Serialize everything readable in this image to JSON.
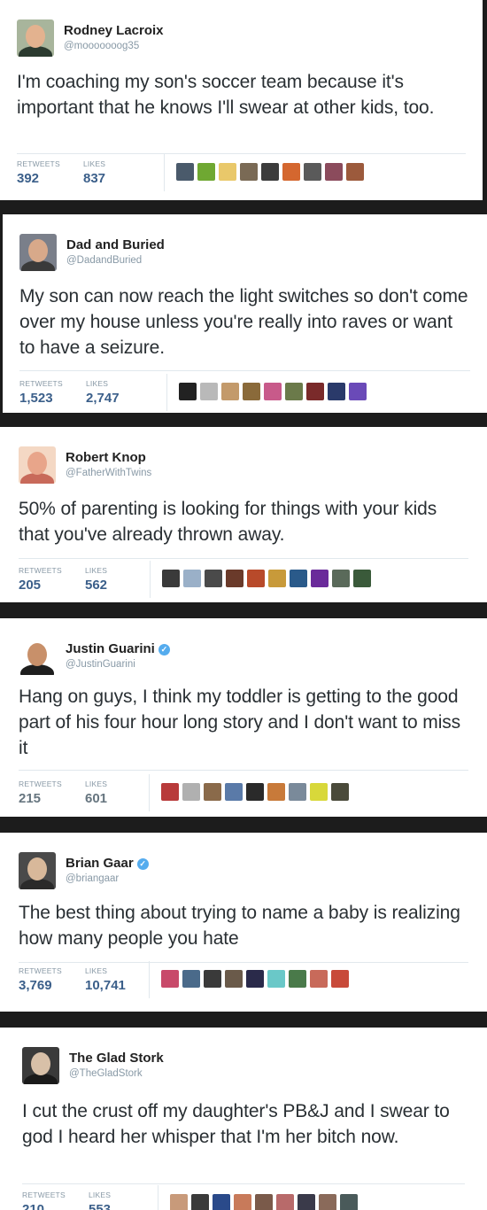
{
  "labels": {
    "retweets": "RETWEETS",
    "likes": "LIKES"
  },
  "tweets": [
    {
      "name": "Rodney Lacroix",
      "handle": "@mooooooog35",
      "verified": false,
      "text": "I'm coaching my son's soccer team because it's important that he knows I'll swear at other kids, too.",
      "retweets": "392",
      "likes": "837",
      "avatar_colors": [
        "#a8b59c",
        "#e3b28f",
        "#2b3a2f"
      ],
      "liker_colors": [
        "#4a5a6b",
        "#6fa832",
        "#e9c86a",
        "#7a6a55",
        "#3c3c3c",
        "#d4672f",
        "#5a5a5a",
        "#8b4b5c",
        "#9c5a3c"
      ]
    },
    {
      "name": "Dad and Buried",
      "handle": "@DadandBuried",
      "verified": false,
      "text": "My son can now reach the light switches so don't come over my house unless you're really into raves or want to have a seizure.",
      "retweets": "1,523",
      "likes": "2,747",
      "avatar_colors": [
        "#7a7f8a",
        "#d8a98a",
        "#3a3a3a"
      ],
      "liker_colors": [
        "#222222",
        "#b9b9b9",
        "#c39a6b",
        "#8a6a3a",
        "#c85a8a",
        "#6b7a4a",
        "#7a2a2a",
        "#2a3a6a",
        "#6a4ab8"
      ]
    },
    {
      "name": "Robert Knop",
      "handle": "@FatherWithTwins",
      "verified": false,
      "text": "50% of parenting is looking for things with your kids that you've already thrown away.",
      "retweets": "205",
      "likes": "562",
      "avatar_colors": [
        "#f4d8c4",
        "#e8a58a",
        "#c86a5a"
      ],
      "liker_colors": [
        "#3a3a3a",
        "#9ab0c8",
        "#4a4a4a",
        "#6a3a2a",
        "#b84a2a",
        "#c89a3a",
        "#2a5a8a",
        "#6a2a9a",
        "#5a6a5a",
        "#3a5a3a"
      ]
    },
    {
      "name": "Justin Guarini",
      "handle": "@JustinGuarini",
      "verified": true,
      "text": "Hang on guys, I think my toddler is getting to the good part of his four hour long story and I don't want to miss it",
      "retweets": "215",
      "likes": "601",
      "avatar_colors": [
        "#ffffff",
        "#c8906a",
        "#1e1e1e"
      ],
      "liker_colors": [
        "#b83a3a",
        "#b0b0b0",
        "#8a6a4a",
        "#5a7aa8",
        "#2a2a2a",
        "#c87a3a",
        "#7a8a9a",
        "#d8d83a",
        "#4a4a3a"
      ]
    },
    {
      "name": "Brian Gaar",
      "handle": "@briangaar",
      "verified": true,
      "text": "The best thing about trying to name a baby is realizing how many people you hate",
      "retweets": "3,769",
      "likes": "10,741",
      "avatar_colors": [
        "#4a4a4a",
        "#d8b89a",
        "#2a2a2a"
      ],
      "liker_colors": [
        "#c84a6a",
        "#4a6a8a",
        "#3a3a3a",
        "#6a5a4a",
        "#2a2a4a",
        "#6ac8c8",
        "#4a7a4a",
        "#c86a5a",
        "#c84a3a"
      ]
    },
    {
      "name": "The Glad Stork",
      "handle": "@TheGladStork",
      "verified": false,
      "text": "I cut the crust off my daughter's PB&J and I swear to god I heard her whisper that I'm her bitch now.",
      "retweets": "210",
      "likes": "553",
      "avatar_colors": [
        "#3a3a3a",
        "#d8c0a8",
        "#1a1a1a"
      ],
      "liker_colors": [
        "#c89a7a",
        "#3a3a3a",
        "#2a4a8a",
        "#c87a5a",
        "#7a5a4a",
        "#b86a6a",
        "#3a3a4a",
        "#8a6a5a",
        "#4a5a5a"
      ]
    }
  ]
}
